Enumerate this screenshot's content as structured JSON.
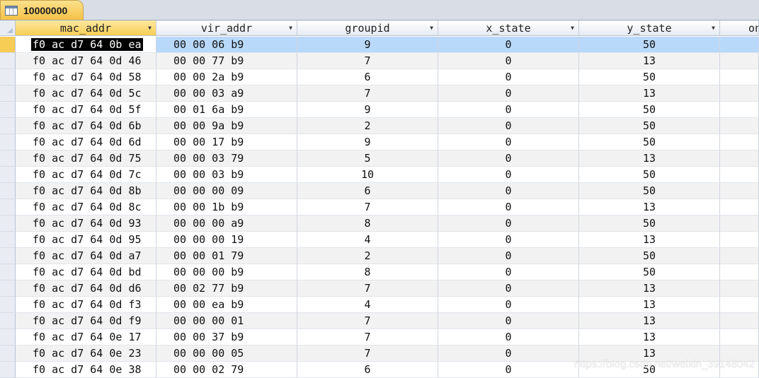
{
  "tab": {
    "label": "10000000",
    "icon": "table-icon"
  },
  "columns": [
    {
      "key": "mac_addr",
      "label": "mac_addr"
    },
    {
      "key": "vir_addr",
      "label": "vir_addr"
    },
    {
      "key": "groupid",
      "label": "groupid"
    },
    {
      "key": "x_state",
      "label": "x_state"
    },
    {
      "key": "y_state",
      "label": "y_state"
    },
    {
      "key": "on",
      "label": "on"
    }
  ],
  "rows": [
    [
      "f0 ac d7 64 0b ea",
      "00 00 06 b9",
      "9",
      "0",
      "50",
      ""
    ],
    [
      "f0 ac d7 64 0d 46",
      "00 00 77 b9",
      "7",
      "0",
      "13",
      ""
    ],
    [
      "f0 ac d7 64 0d 58",
      "00 00 2a b9",
      "6",
      "0",
      "50",
      ""
    ],
    [
      "f0 ac d7 64 0d 5c",
      "00 00 03 a9",
      "7",
      "0",
      "13",
      ""
    ],
    [
      "f0 ac d7 64 0d 5f",
      "00 01 6a b9",
      "9",
      "0",
      "50",
      ""
    ],
    [
      "f0 ac d7 64 0d 6b",
      "00 00 9a b9",
      "2",
      "0",
      "50",
      ""
    ],
    [
      "f0 ac d7 64 0d 6d",
      "00 00 17 b9",
      "9",
      "0",
      "50",
      ""
    ],
    [
      "f0 ac d7 64 0d 75",
      "00 00 03 79",
      "5",
      "0",
      "13",
      ""
    ],
    [
      "f0 ac d7 64 0d 7c",
      "00 00 03 b9",
      "10",
      "0",
      "50",
      ""
    ],
    [
      "f0 ac d7 64 0d 8b",
      "00 00 00 09",
      "6",
      "0",
      "50",
      ""
    ],
    [
      "f0 ac d7 64 0d 8c",
      "00 00 1b b9",
      "7",
      "0",
      "13",
      ""
    ],
    [
      "f0 ac d7 64 0d 93",
      "00 00 00 a9",
      "8",
      "0",
      "50",
      ""
    ],
    [
      "f0 ac d7 64 0d 95",
      "00 00 00 19",
      "4",
      "0",
      "13",
      ""
    ],
    [
      "f0 ac d7 64 0d a7",
      "00 00 01 79",
      "2",
      "0",
      "50",
      ""
    ],
    [
      "f0 ac d7 64 0d bd",
      "00 00 00 b9",
      "8",
      "0",
      "50",
      ""
    ],
    [
      "f0 ac d7 64 0d d6",
      "00 02 77 b9",
      "7",
      "0",
      "13",
      ""
    ],
    [
      "f0 ac d7 64 0d f3",
      "00 00 ea b9",
      "4",
      "0",
      "13",
      ""
    ],
    [
      "f0 ac d7 64 0d f9",
      "00 00 00 01",
      "7",
      "0",
      "13",
      ""
    ],
    [
      "f0 ac d7 64 0e 17",
      "00 00 37 b9",
      "7",
      "0",
      "13",
      ""
    ],
    [
      "f0 ac d7 64 0e 23",
      "00 00 00 05",
      "7",
      "0",
      "13",
      ""
    ],
    [
      "f0 ac d7 64 0e 38",
      "00 00 02 79",
      "6",
      "0",
      "50",
      ""
    ]
  ],
  "watermark": "https://blog.csdn.net/weixin_39148042",
  "colors": {
    "tab_active": "#f7cd55",
    "selected_row": "#b9d9fb",
    "alt_row": "#f2f2f2"
  }
}
